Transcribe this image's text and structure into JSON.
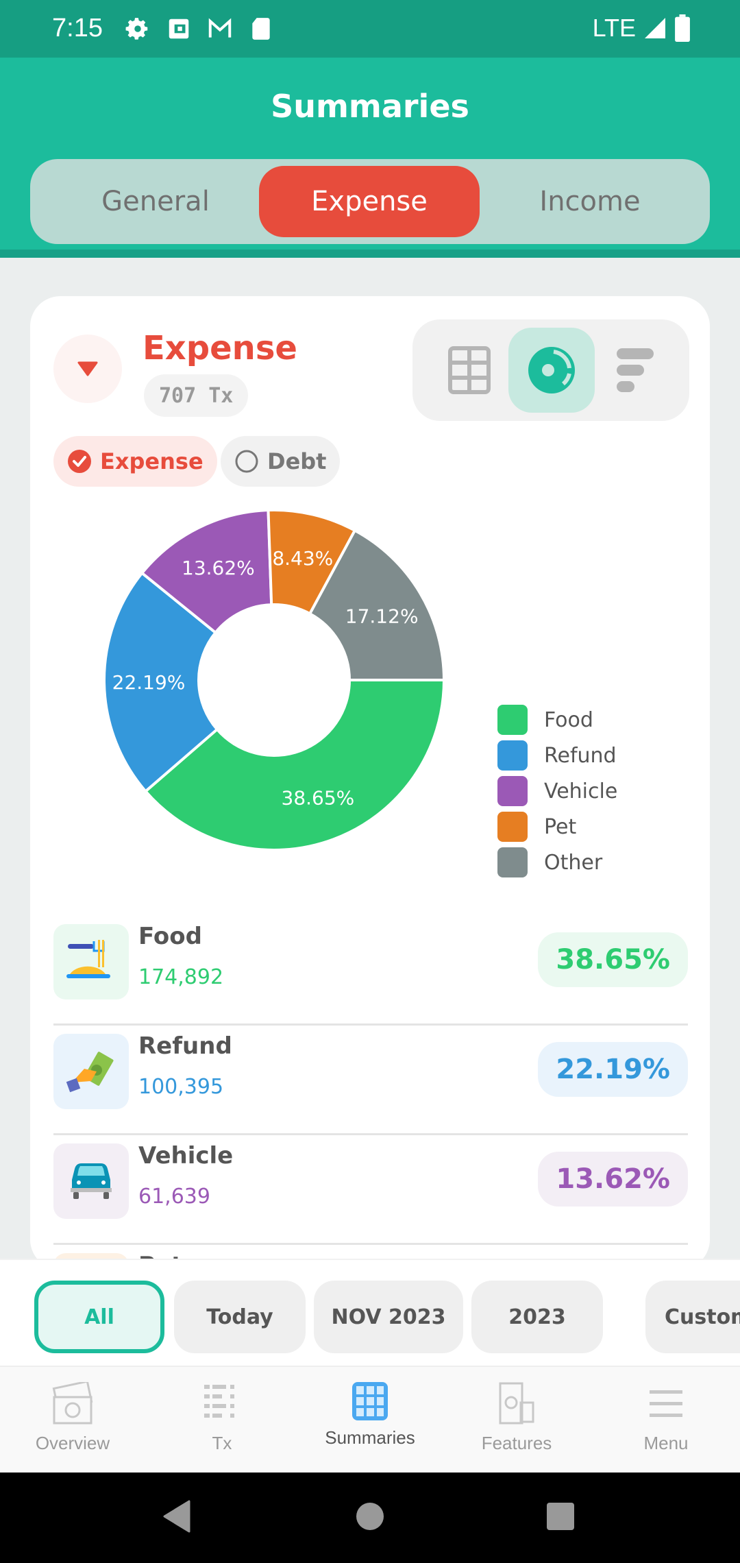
{
  "status_bar": {
    "time": "7:15",
    "network": "LTE",
    "icons": [
      "gear-icon",
      "wallet-icon",
      "gmail-icon",
      "sd-card-icon"
    ]
  },
  "header": {
    "title": "Summaries",
    "tabs": [
      {
        "label": "General",
        "active": false
      },
      {
        "label": "Expense",
        "active": true
      },
      {
        "label": "Income",
        "active": false
      }
    ]
  },
  "card": {
    "title": "Expense",
    "tx_count": "707 Tx",
    "view_modes": [
      {
        "icon": "table-icon",
        "active": false
      },
      {
        "icon": "donut-chart-icon",
        "active": true
      },
      {
        "icon": "bar-list-icon",
        "active": false
      }
    ],
    "filters": [
      {
        "label": "Expense",
        "checked": true
      },
      {
        "label": "Debt",
        "checked": false
      }
    ]
  },
  "chart_data": {
    "type": "pie",
    "variant": "donut",
    "start_angle": "east (3 o'clock), clockwise",
    "categories": [
      "Food",
      "Refund",
      "Vehicle",
      "Pet",
      "Other"
    ],
    "values": [
      38.65,
      22.19,
      13.62,
      8.43,
      17.12
    ],
    "labels": [
      "38.65%",
      "22.19%",
      "13.62%",
      "8.43%",
      "17.12%"
    ],
    "colors": [
      "#2ecc71",
      "#3498db",
      "#9b59b6",
      "#e67e22",
      "#7f8c8d"
    ],
    "legend": [
      "Food",
      "Refund",
      "Vehicle",
      "Pet",
      "Other"
    ],
    "legend_position": "right"
  },
  "categories": [
    {
      "name": "Food",
      "amount": "174,892",
      "percent": "38.65%",
      "color": "#2ecc71",
      "bg": "#eaf9f0",
      "icon": "food-icon"
    },
    {
      "name": "Refund",
      "amount": "100,395",
      "percent": "22.19%",
      "color": "#3498db",
      "bg": "#e9f3fc",
      "icon": "refund-icon"
    },
    {
      "name": "Vehicle",
      "amount": "61,639",
      "percent": "13.62%",
      "color": "#9b59b6",
      "bg": "#f3eef5",
      "icon": "car-icon"
    },
    {
      "name": "Pet",
      "amount": "",
      "percent": "",
      "color": "#e67e22",
      "bg": "#fdf1e4",
      "icon": "pet-icon"
    }
  ],
  "period_filters": [
    {
      "label": "All",
      "active": true
    },
    {
      "label": "Today",
      "active": false
    },
    {
      "label": "NOV 2023",
      "active": false
    },
    {
      "label": "2023",
      "active": false
    },
    {
      "label": "Custom",
      "active": false
    }
  ],
  "bottom_nav": [
    {
      "label": "Overview",
      "icon": "money-icon",
      "active": false
    },
    {
      "label": "Tx",
      "icon": "list-icon",
      "active": false
    },
    {
      "label": "Summaries",
      "icon": "grid-icon",
      "active": true
    },
    {
      "label": "Features",
      "icon": "features-icon",
      "active": false
    },
    {
      "label": "Menu",
      "icon": "hamburger-icon",
      "active": false
    }
  ],
  "colors": {
    "primary": "#1cbc9c",
    "expense": "#e74c3c"
  }
}
